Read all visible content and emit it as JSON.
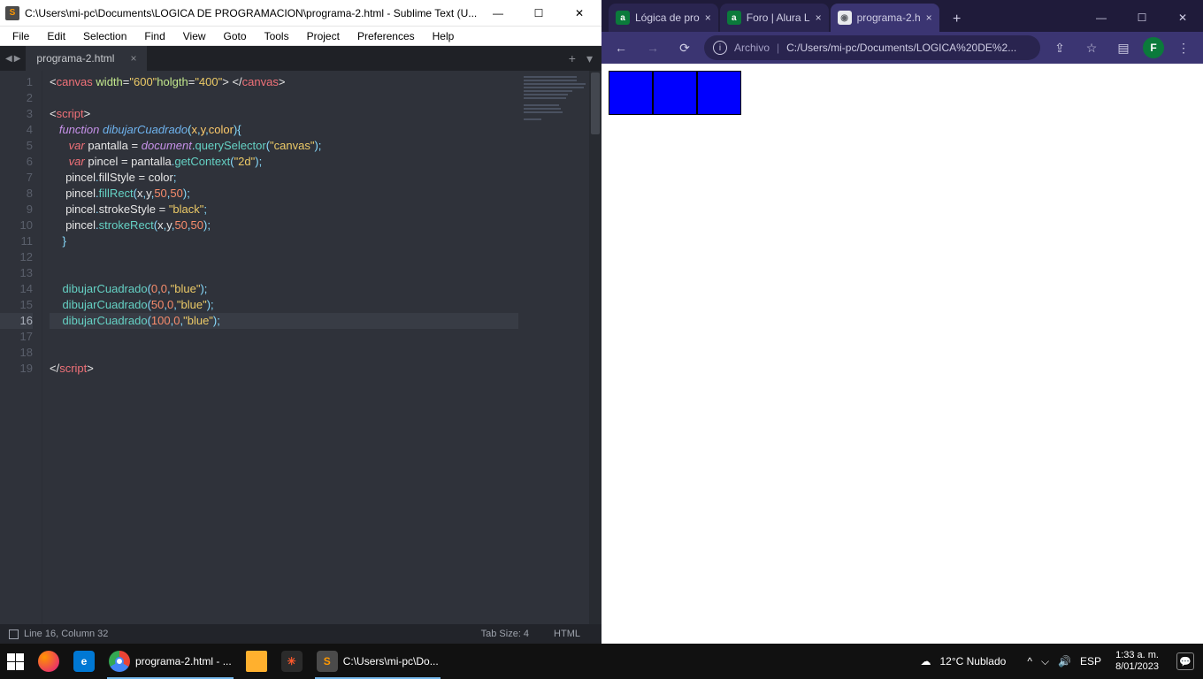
{
  "sublime": {
    "titlebar": {
      "icon_text": "S",
      "title": "C:\\Users\\mi-pc\\Documents\\LOGICA DE PROGRAMACION\\programa-2.html - Sublime Text (U...",
      "min": "—",
      "max": "☐",
      "close": "✕"
    },
    "menu": [
      "File",
      "Edit",
      "Selection",
      "Find",
      "View",
      "Goto",
      "Tools",
      "Project",
      "Preferences",
      "Help"
    ],
    "nav_back": "◀",
    "nav_fwd": "▶",
    "tab": {
      "name": "programa-2.html",
      "close": "×"
    },
    "tabs_plus": "+",
    "tabs_more": "▾",
    "line_numbers": [
      "1",
      "2",
      "3",
      "4",
      "5",
      "6",
      "7",
      "8",
      "9",
      "10",
      "11",
      "12",
      "13",
      "14",
      "15",
      "16",
      "17",
      "18",
      "19"
    ],
    "active_line_index": 15,
    "status": {
      "cursor": "Line 16, Column 32",
      "tabsize": "Tab Size: 4",
      "syntax": "HTML"
    }
  },
  "chrome": {
    "tabs": [
      {
        "fav_bg": "#0b7a3b",
        "fav_fg": "#fff",
        "fav_txt": "a",
        "title": "Lógica de pro",
        "active": false
      },
      {
        "fav_bg": "#0b7a3b",
        "fav_fg": "#fff",
        "fav_txt": "a",
        "title": "Foro | Alura L",
        "active": false
      },
      {
        "fav_bg": "#e8eaed",
        "fav_fg": "#5f6368",
        "fav_txt": "◉",
        "title": "programa-2.h",
        "active": true
      }
    ],
    "tab_close": "×",
    "newtab": "+",
    "win": {
      "min": "—",
      "max": "☐",
      "close": "✕"
    },
    "nav": {
      "back": "←",
      "fwd": "→",
      "reload": "⟳"
    },
    "url": {
      "info": "i",
      "label": "Archivo",
      "sep": "|",
      "path": "C:/Users/mi-pc/Documents/LOGICA%20DE%2..."
    },
    "toolbar": {
      "share": "⇪",
      "star": "☆",
      "side": "▤",
      "avatar": "F",
      "menu": "⋮"
    },
    "squares": [
      1,
      2,
      3
    ]
  },
  "taskbar": {
    "items": [
      {
        "kind": "start"
      },
      {
        "kind": "icon",
        "bg": "#ff7139",
        "txt": "",
        "svg": "ff"
      },
      {
        "kind": "icon",
        "bg": "#0078d4",
        "txt": "e"
      },
      {
        "kind": "running",
        "bg": "#fff",
        "svg": "chrome",
        "label": "programa-2.html - ..."
      },
      {
        "kind": "icon",
        "bg": "#f0b429",
        "svg": "folder"
      },
      {
        "kind": "icon",
        "bg": "#2b2b2b",
        "txt": "✳",
        "fg": "#ff5a2c"
      },
      {
        "kind": "running",
        "bg": "#4b4b4b",
        "txt": "S",
        "fg": "#ff9800",
        "label": "C:\\Users\\mi-pc\\Do..."
      }
    ],
    "weather_icon": "☁",
    "weather": "12°C  Nublado",
    "tray": {
      "chev": "^",
      "net": "⌵",
      "vol": "🔊",
      "lang": "ESP"
    },
    "clock": {
      "time": "1:33 a. m.",
      "date": "8/01/2023"
    },
    "speech": "💬"
  }
}
